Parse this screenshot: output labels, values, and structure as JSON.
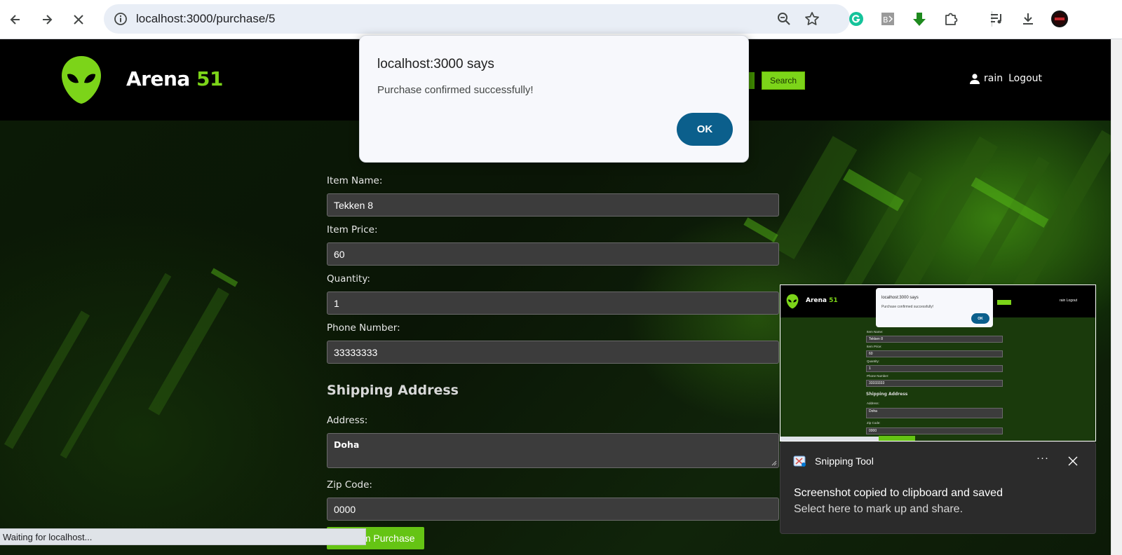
{
  "browser": {
    "url": "localhost:3000/purchase/5",
    "status_text": "Waiting for localhost..."
  },
  "site": {
    "brand_name": "Arena",
    "brand_number": "51",
    "search_label": "Search",
    "username": "rain",
    "logout_label": "Logout",
    "accent_color": "#7cd419"
  },
  "form": {
    "item_name_label": "Item Name:",
    "item_name_value": "Tekken 8",
    "item_price_label": "Item Price:",
    "item_price_value": "60",
    "quantity_label": "Quantity:",
    "quantity_value": "1",
    "phone_label": "Phone Number:",
    "phone_value": "33333333",
    "shipping_heading": "Shipping Address",
    "address_label": "Address:",
    "address_value": "Doha",
    "zip_label": "Zip Code:",
    "zip_value": "0000",
    "confirm_label": "Confirm Purchase"
  },
  "dialog": {
    "title": "localhost:3000 says",
    "message": "Purchase confirmed successfully!",
    "ok_label": "OK"
  },
  "thumbnail": {
    "dialog_title": "localhost:3000 says",
    "dialog_message": "Purchase confirmed successfully!",
    "ok_label": "OK",
    "brand_name": "Arena",
    "brand_number": "51",
    "user_text": "rain Logout",
    "item_name_label": "Item Name:",
    "item_name_value": "Tekken 8",
    "item_price_label": "Item Price:",
    "item_price_value": "60",
    "quantity_label": "Quantity:",
    "quantity_value": "1",
    "phone_label": "Phone Number:",
    "phone_value": "33333333",
    "shipping_heading": "Shipping Address",
    "address_label": "Address:",
    "address_value": "Doha",
    "zip_label": "Zip Code:",
    "zip_value": "0000"
  },
  "toast": {
    "app_name": "Snipping Tool",
    "more_label": "···",
    "title": "Screenshot copied to clipboard and saved",
    "body": "Select here to mark up and share."
  }
}
